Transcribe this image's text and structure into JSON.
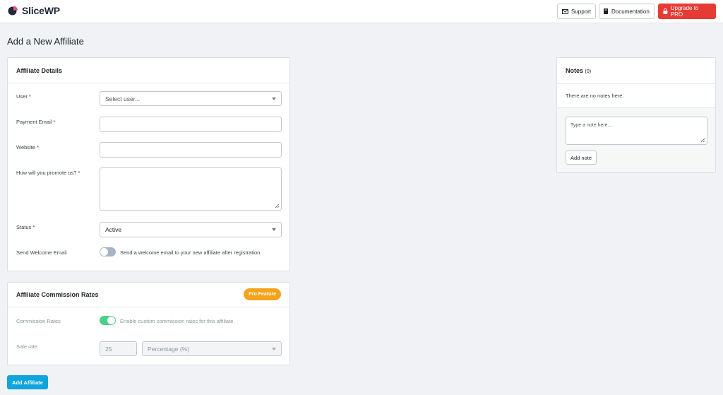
{
  "header": {
    "brand": "SliceWP",
    "support_label": "Support",
    "documentation_label": "Documentation",
    "upgrade_label": "Upgrade to PRO"
  },
  "page": {
    "title": "Add a New Affiliate"
  },
  "affiliate_details": {
    "title": "Affiliate Details",
    "user_label": "User",
    "user_placeholder": "Select user...",
    "payment_email_label": "Payment Email",
    "payment_email_value": "",
    "website_label": "Website",
    "website_value": "",
    "promote_label": "How will you promote us?",
    "promote_value": "",
    "status_label": "Status",
    "status_value": "Active",
    "welcome_label": "Send Welcome Email",
    "welcome_text": "Send a welcome email to your new affiliate after registration.",
    "welcome_enabled": false,
    "required_mark": "*"
  },
  "commission": {
    "title": "Affiliate Commission Rates",
    "pro_badge": "Pro Feature",
    "rates_label": "Commission Rates",
    "rates_text": "Enable custom commission rates for this affiliate.",
    "rates_enabled": true,
    "sale_rate_label": "Sale rate",
    "sale_rate_value": "25",
    "sale_rate_type": "Percentage (%)"
  },
  "actions": {
    "add_affiliate_label": "Add Affiliate"
  },
  "notes": {
    "title": "Notes",
    "count": "(0)",
    "empty_text": "There are no notes here.",
    "note_placeholder": "Type a note here...",
    "add_note_label": "Add note"
  },
  "colors": {
    "upgrade": "#e63b34",
    "pro_badge": "#f4a31b",
    "primary_button": "#0ea5dd",
    "toggle_on": "#4ccf88",
    "toggle_off": "#a7b4c4"
  }
}
